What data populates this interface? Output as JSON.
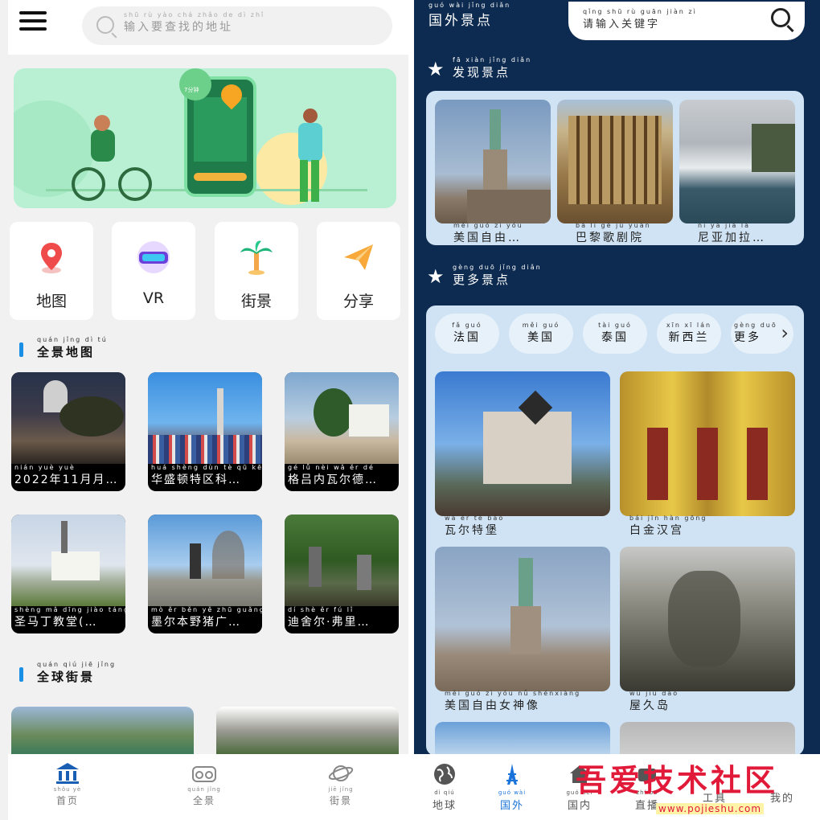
{
  "left": {
    "search": {
      "pinyin": "shū rù yào chá zhǎo de dì zhǐ",
      "placeholder": "输入要查找的地址"
    },
    "banner": {
      "time_label": "7分钟"
    },
    "tiles": [
      {
        "label": "地图",
        "icon": "map-pin-icon"
      },
      {
        "label": "VR",
        "icon": "vr-headset-icon"
      },
      {
        "label": "街景",
        "icon": "palm-tree-icon"
      },
      {
        "label": "分享",
        "icon": "paper-plane-icon"
      }
    ],
    "section1": {
      "pinyin": "quán jǐng dì tú",
      "title": "全景地图"
    },
    "section2": {
      "pinyin": "quán qiú jiē jǐng",
      "title": "全球街景"
    },
    "cards": [
      {
        "pinyin": "nián yuè yuè",
        "title": "2022年11月月…"
      },
      {
        "pinyin": "huá shèng dùn tè qū kē",
        "title": "华盛顿特区科…"
      },
      {
        "pinyin": "gé lǚ nèi wǎ ěr dé",
        "title": "格吕内瓦尔德…"
      },
      {
        "pinyin": "shèng mǎ dīng jiào táng",
        "title": "圣马丁教堂(…"
      },
      {
        "pinyin": "mò ěr běn yě zhū guǎng",
        "title": "墨尔本野猪广…"
      },
      {
        "pinyin": "dí shè ěr fú lǐ",
        "title": "迪舍尔·弗里…"
      }
    ],
    "nav": [
      {
        "pinyin": "shǒu yè",
        "label": "首页",
        "icon": "museum-icon"
      },
      {
        "pinyin": "quán jǐng",
        "label": "全景",
        "icon": "vr-glasses-icon"
      },
      {
        "pinyin": "jiē jǐng",
        "label": "街景",
        "icon": "planet-icon"
      }
    ]
  },
  "right": {
    "title": {
      "pinyin": "guó wài jǐng diǎn",
      "text": "国外景点"
    },
    "search": {
      "pinyin": "qǐng shū rù guān jiàn zì",
      "placeholder": "请输入关键字"
    },
    "discover": {
      "pinyin": "fā xiàn jǐng diǎn",
      "title": "发现景点"
    },
    "discover_cards": [
      {
        "pinyin": "měi guó zì yóu",
        "title": "美国自由…"
      },
      {
        "pinyin": "bā lí gē jù yuàn",
        "title": "巴黎歌剧院"
      },
      {
        "pinyin": "ní yà jiā lā",
        "title": "尼亚加拉…"
      }
    ],
    "more": {
      "pinyin": "gèng duō jǐng diǎn",
      "title": "更多景点"
    },
    "pills": [
      {
        "pinyin": "fǎ guó",
        "label": "法国"
      },
      {
        "pinyin": "měi guó",
        "label": "美国"
      },
      {
        "pinyin": "tài guó",
        "label": "泰国"
      },
      {
        "pinyin": "xīn xī lán",
        "label": "新西兰"
      },
      {
        "pinyin": "gèng duō",
        "label": "更多"
      }
    ],
    "grid_cards": [
      {
        "pinyin": "wǎ ěr tè bǎo",
        "title": "瓦尔特堡"
      },
      {
        "pinyin": "bái jīn hàn gōng",
        "title": "白金汉宫"
      },
      {
        "pinyin": "měi guó zì yóu nǚ shénxiàng",
        "title": "美国自由女神像"
      },
      {
        "pinyin": "wū jiǔ dǎo",
        "title": "屋久岛"
      }
    ],
    "nav": [
      {
        "pinyin": "dì qiú",
        "label": "地球",
        "icon": "globe-icon"
      },
      {
        "pinyin": "guó wài",
        "label": "国外",
        "icon": "eiffel-tower-icon"
      },
      {
        "pinyin": "guó nèi",
        "label": "国内",
        "icon": "house-icon"
      },
      {
        "pinyin": "zhí bō",
        "label": "直播",
        "icon": "live-icon"
      },
      {
        "pinyin": "",
        "label": "工具",
        "icon": "tools-icon"
      },
      {
        "pinyin": "",
        "label": "我的",
        "icon": "user-icon"
      }
    ]
  },
  "watermark": {
    "text": "吾爱技术社区",
    "url": "www.pojieshu.com"
  },
  "colors": {
    "accent_blue": "#1a73d9",
    "dark_navy": "#0d2b50",
    "panel_blue": "#cfe3f4",
    "watermark_red": "#e21a3a"
  }
}
